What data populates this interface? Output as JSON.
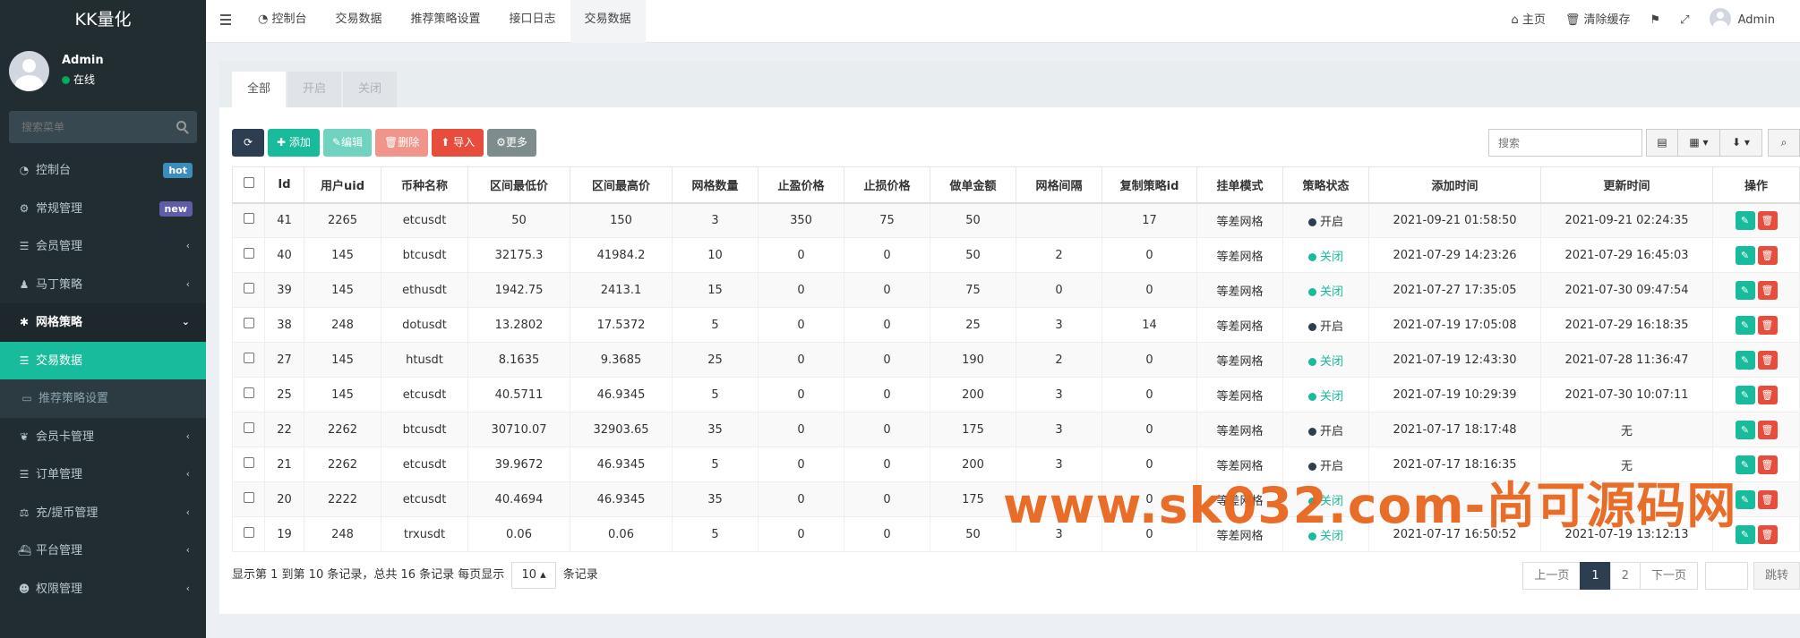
{
  "app": {
    "logo": "KK量化"
  },
  "user_panel": {
    "name": "Admin",
    "status": "在线"
  },
  "sidebar_search": {
    "placeholder": "搜索菜单"
  },
  "menu": [
    {
      "label": "控制台",
      "icon": "dashboard-icon",
      "badge": "hot",
      "badge_color": "#3c8dbc"
    },
    {
      "label": "常规管理",
      "icon": "cogs-icon",
      "badge": "new",
      "badge_color": "#605ca8"
    },
    {
      "label": "会员管理",
      "icon": "list-icon",
      "arrow": "‹"
    },
    {
      "label": "马丁策略",
      "icon": "android-icon",
      "arrow": "‹"
    },
    {
      "label": "网格策略",
      "icon": "bug-icon",
      "arrow": "⌄"
    },
    {
      "label": "交易数据",
      "icon": "list-icon"
    },
    {
      "label": "推荐策略设置",
      "icon": "calendar-icon"
    },
    {
      "label": "会员卡管理",
      "icon": "leaf-icon",
      "arrow": "‹"
    },
    {
      "label": "订单管理",
      "icon": "list-icon",
      "arrow": "‹"
    },
    {
      "label": "充/提币管理",
      "icon": "balance-icon",
      "arrow": "‹"
    },
    {
      "label": "平台管理",
      "icon": "ship-icon",
      "arrow": "‹"
    },
    {
      "label": "权限管理",
      "icon": "group-icon",
      "arrow": "‹"
    }
  ],
  "topnav": [
    "控制台",
    "交易数据",
    "推荐策略设置",
    "接口日志",
    "交易数据"
  ],
  "topright": {
    "home": "主页",
    "clear_cache": "清除缓存",
    "admin": "Admin"
  },
  "panel_tabs": [
    "全部",
    "开启",
    "关闭"
  ],
  "toolbar": {
    "add": "添加",
    "edit": "编辑",
    "delete": "删除",
    "import": "导入",
    "more": "更多"
  },
  "table_search": {
    "placeholder": "搜索"
  },
  "columns": [
    "Id",
    "用户uid",
    "币种名称",
    "区间最低价",
    "区间最高价",
    "网格数量",
    "止盈价格",
    "止损价格",
    "做单金额",
    "网格间隔",
    "复制策略id",
    "挂单模式",
    "策略状态",
    "添加时间",
    "更新时间",
    "操作"
  ],
  "rows": [
    {
      "id": "41",
      "uid": "2265",
      "coin": "etcusdt",
      "low": "50",
      "high": "150",
      "grids": "3",
      "tp": "350",
      "sl": "75",
      "amount": "50",
      "interval": "",
      "copy_id": "17",
      "mode": "等差网格",
      "status": "开启",
      "status_on": true,
      "created": "2021-09-21 01:58:50",
      "updated": "2021-09-21 02:24:35"
    },
    {
      "id": "40",
      "uid": "145",
      "coin": "btcusdt",
      "low": "32175.3",
      "high": "41984.2",
      "grids": "10",
      "tp": "0",
      "sl": "0",
      "amount": "50",
      "interval": "2",
      "copy_id": "0",
      "mode": "等差网格",
      "status": "关闭",
      "status_on": false,
      "created": "2021-07-29 14:23:26",
      "updated": "2021-07-29 16:45:03"
    },
    {
      "id": "39",
      "uid": "145",
      "coin": "ethusdt",
      "low": "1942.75",
      "high": "2413.1",
      "grids": "15",
      "tp": "0",
      "sl": "0",
      "amount": "75",
      "interval": "0",
      "copy_id": "0",
      "mode": "等差网格",
      "status": "关闭",
      "status_on": false,
      "created": "2021-07-27 17:35:05",
      "updated": "2021-07-30 09:47:54"
    },
    {
      "id": "38",
      "uid": "248",
      "coin": "dotusdt",
      "low": "13.2802",
      "high": "17.5372",
      "grids": "5",
      "tp": "0",
      "sl": "0",
      "amount": "25",
      "interval": "3",
      "copy_id": "14",
      "mode": "等差网格",
      "status": "开启",
      "status_on": true,
      "created": "2021-07-19 17:05:08",
      "updated": "2021-07-29 16:18:35"
    },
    {
      "id": "27",
      "uid": "145",
      "coin": "htusdt",
      "low": "8.1635",
      "high": "9.3685",
      "grids": "25",
      "tp": "0",
      "sl": "0",
      "amount": "190",
      "interval": "2",
      "copy_id": "0",
      "mode": "等差网格",
      "status": "关闭",
      "status_on": false,
      "created": "2021-07-19 12:43:30",
      "updated": "2021-07-28 11:36:47"
    },
    {
      "id": "25",
      "uid": "145",
      "coin": "etcusdt",
      "low": "40.5711",
      "high": "46.9345",
      "grids": "5",
      "tp": "0",
      "sl": "0",
      "amount": "200",
      "interval": "3",
      "copy_id": "0",
      "mode": "等差网格",
      "status": "关闭",
      "status_on": false,
      "created": "2021-07-19 10:29:39",
      "updated": "2021-07-30 10:07:11"
    },
    {
      "id": "22",
      "uid": "2262",
      "coin": "btcusdt",
      "low": "30710.07",
      "high": "32903.65",
      "grids": "35",
      "tp": "0",
      "sl": "0",
      "amount": "175",
      "interval": "3",
      "copy_id": "0",
      "mode": "等差网格",
      "status": "开启",
      "status_on": true,
      "created": "2021-07-17 18:17:48",
      "updated": "无"
    },
    {
      "id": "21",
      "uid": "2262",
      "coin": "etcusdt",
      "low": "39.9672",
      "high": "46.9345",
      "grids": "5",
      "tp": "0",
      "sl": "0",
      "amount": "200",
      "interval": "3",
      "copy_id": "0",
      "mode": "等差网格",
      "status": "开启",
      "status_on": true,
      "created": "2021-07-17 18:16:35",
      "updated": "无"
    },
    {
      "id": "20",
      "uid": "2222",
      "coin": "etcusdt",
      "low": "40.4694",
      "high": "46.9345",
      "grids": "35",
      "tp": "0",
      "sl": "0",
      "amount": "175",
      "interval": "",
      "copy_id": "0",
      "mode": "等差网格",
      "status": "关闭",
      "status_on": false,
      "created": "",
      "updated": ""
    },
    {
      "id": "19",
      "uid": "248",
      "coin": "trxusdt",
      "low": "0.06",
      "high": "0.06",
      "grids": "5",
      "tp": "0",
      "sl": "0",
      "amount": "50",
      "interval": "3",
      "copy_id": "0",
      "mode": "等差网格",
      "status": "关闭",
      "status_on": false,
      "created": "2021-07-17 16:50:52",
      "updated": "2021-07-19 13:12:13"
    }
  ],
  "pager": {
    "info_prefix": "显示第 1 到第 10 条记录，总共 16 条记录 每页显示",
    "page_size": "10",
    "info_suffix": "条记录",
    "prev": "上一页",
    "pages": [
      "1",
      "2"
    ],
    "next": "下一页",
    "jump": "跳转"
  },
  "watermark": "www.sk032.com-尚可源码网",
  "colors": {
    "sidebar_bg": "#222d32",
    "accent": "#18bc9c",
    "danger": "#e74c3c",
    "dark": "#2c3e50"
  }
}
